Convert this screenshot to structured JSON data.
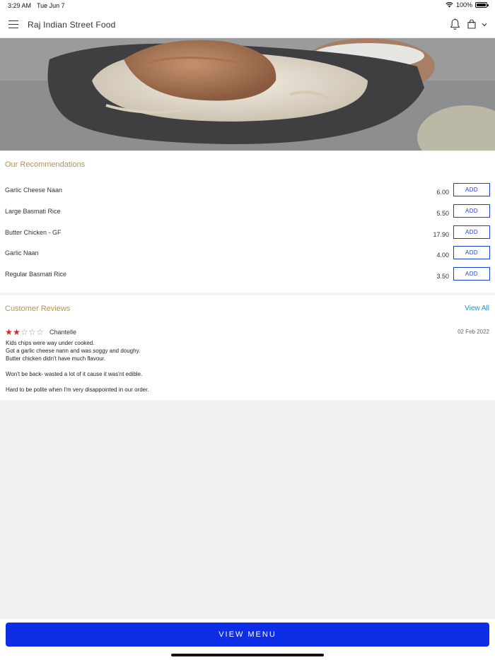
{
  "status_bar": {
    "time": "3:29 AM",
    "date": "Tue Jun 7",
    "battery": "100%",
    "icons": [
      "wifi-icon",
      "battery-icon"
    ]
  },
  "header": {
    "title": "Raj Indian Street Food",
    "icons": [
      "hamburger-menu-icon",
      "bell-icon",
      "shopping-bag-icon",
      "chevron-down-icon"
    ]
  },
  "recommendations": {
    "title": "Our Recommendations",
    "add_label": "ADD",
    "items": [
      {
        "name": "Garlic Cheese Naan",
        "price": "6.00"
      },
      {
        "name": "Large Basmati Rice",
        "price": "5.50"
      },
      {
        "name": "Butter Chicken - GF",
        "price": "17.90"
      },
      {
        "name": "Garlic Naan",
        "price": "4.00"
      },
      {
        "name": "Regular Basmati Rice",
        "price": "3.50"
      }
    ]
  },
  "reviews": {
    "title": "Customer Reviews",
    "view_all": "View All",
    "items": [
      {
        "rating": 2,
        "max_rating": 5,
        "author": "Chantelle",
        "date": "02 Feb 2022",
        "lines": [
          "Kids chips were way under cooked.",
          "Got a garlic cheese nann and was soggy and doughy.",
          "Butter chicken didn't have much flavour.",
          "",
          "Won't be back- wasted a lot of it cause it was'nt edible.",
          "",
          "Hard to be polite when I'm very disappointed in our order."
        ]
      }
    ]
  },
  "footer": {
    "view_menu_label": "VIEW MENU"
  },
  "colors": {
    "accent_blue": "#0d2ee6",
    "add_border": "#1a3fd6",
    "section_title": "#b4925c",
    "link": "#2d8fb6",
    "star_on": "#d7242b"
  }
}
